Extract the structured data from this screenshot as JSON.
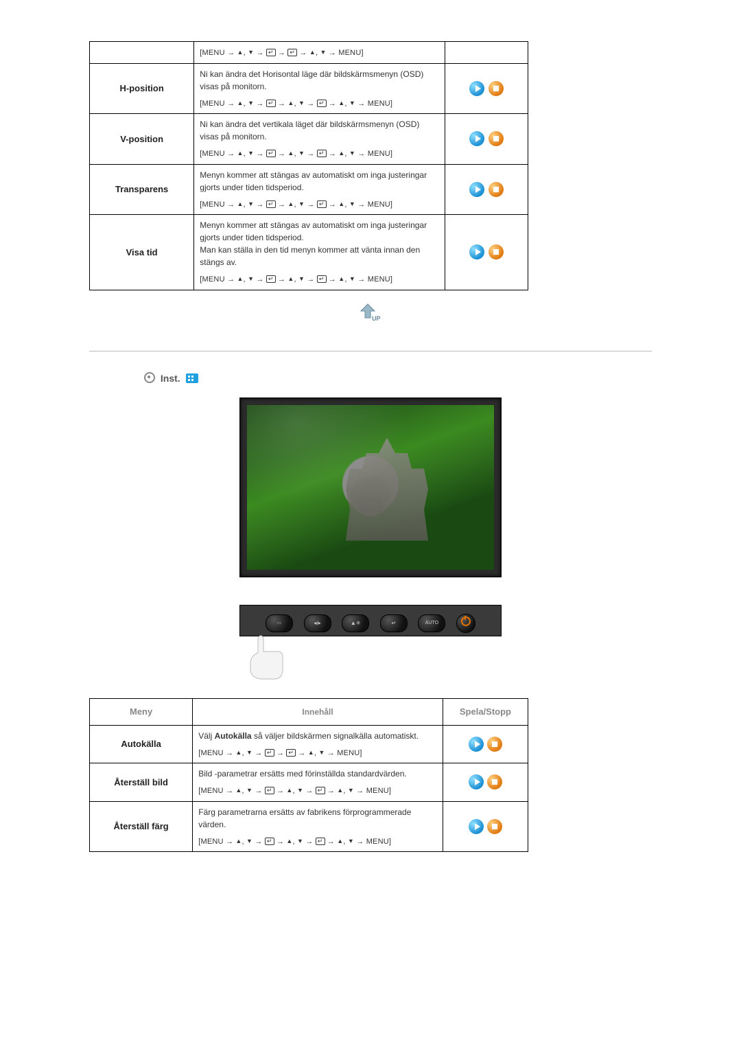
{
  "nav_sequences": {
    "seq_a": "[MENU → ▲, ▼ → ↵ → ↵ → ▲, ▼ → MENU]",
    "seq_b": "[MENU → ▲, ▼ → ↵ → ▲, ▼ → ↵ → ▲, ▼ → MENU]"
  },
  "table1": {
    "rows": [
      {
        "label": "H-position",
        "desc": "Ni kan ändra det Horisontal läge där bildskärmsmenyn (OSD) visas på monitorn.",
        "seq": "seq_b"
      },
      {
        "label": "V-position",
        "desc": "Ni kan ändra det vertikala läget där bildskärmsmenyn (OSD) visas på monitorn.",
        "seq": "seq_b"
      },
      {
        "label": "Transparens",
        "desc": "Menyn kommer att stängas av automatiskt om inga justeringar gjorts under tiden tidsperiod.",
        "seq": "seq_b"
      },
      {
        "label": "Visa tid",
        "desc": "Menyn kommer att stängas av automatiskt om inga justeringar gjorts under tiden tidsperiod.\nMan kan ställa in den tid menyn kommer att vänta innan den stängs av.",
        "seq": "seq_b"
      }
    ],
    "leading_seq": "seq_a"
  },
  "section2": {
    "title": "Inst."
  },
  "controls": {
    "menu": "MENU",
    "source": "▲/▼",
    "adjust": "▲✳",
    "enter": "↵",
    "auto": "AUTO",
    "power": "power"
  },
  "table2": {
    "headers": {
      "col1": "Meny",
      "col2": "Innehåll",
      "col3": "Spela/Stopp"
    },
    "rows": [
      {
        "label": "Autokälla",
        "desc_pre": "Välj ",
        "desc_bold": "Autokälla",
        "desc_post": " så väljer bildskärmen signalkälla automatiskt.",
        "seq": "seq_a"
      },
      {
        "label": "Återställ bild",
        "desc": "Bild -parametrar ersätts med förinställda standardvärden.",
        "seq": "seq_b"
      },
      {
        "label": "Återställ färg",
        "desc": "Färg parametrarna ersätts av fabrikens förprogrammerade värden.",
        "seq": "seq_b"
      }
    ]
  },
  "up_label": "UP"
}
